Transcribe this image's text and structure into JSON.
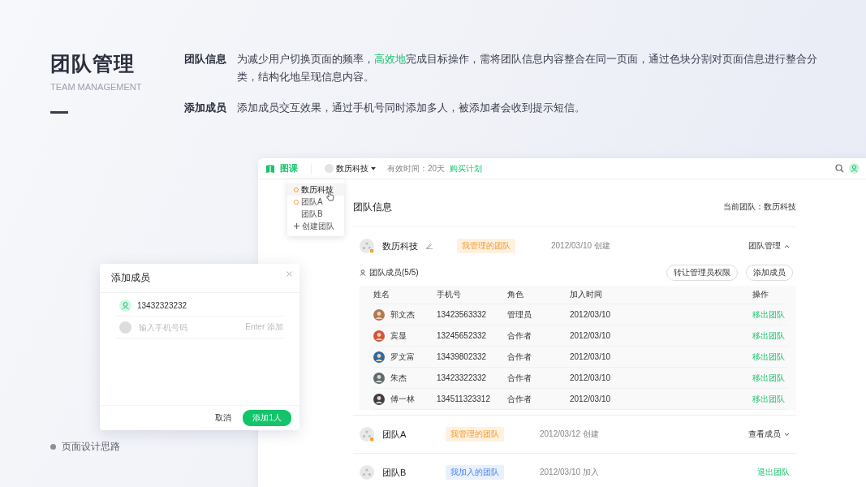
{
  "slide": {
    "title": "团队管理",
    "subtitle": "TEAM MANAGEMENT",
    "footer": "页面设计思路",
    "notes": [
      {
        "label": "团队信息",
        "text": "为减少用户切换页面的频率，**高效地**完成目标操作，需将团队信息内容整合在同一页面，通过色块分割对页面信息进行整合分类，结构化地呈现信息内容。"
      },
      {
        "label": "添加成员",
        "text": "添加成员交互效果，通过手机号同时添加多人，被添加者会收到提示短信。"
      }
    ]
  },
  "app": {
    "logo": "图课",
    "team_switcher": "数历科技",
    "validity": "有效时间：20天",
    "purchase_link": "购买计划",
    "team_menu": [
      {
        "kind": "team",
        "label": "数历科技",
        "managed": true,
        "selected": true
      },
      {
        "kind": "team",
        "label": "团队A",
        "managed": true,
        "selected": false
      },
      {
        "kind": "team",
        "label": "团队B",
        "managed": false,
        "selected": false
      },
      {
        "kind": "create",
        "label": "创建团队",
        "selected": false
      }
    ],
    "page_title": "团队信息",
    "current_team_label": "当前团队：",
    "current_team": "数历科技",
    "teams": [
      {
        "name": "数历科技",
        "editable": true,
        "tag": {
          "kind": "managed",
          "label": "我管理的团队"
        },
        "date": "2012/03/10 创建",
        "action": {
          "kind": "toggle",
          "label": "团队管理"
        },
        "expanded": true,
        "members_label": "团队成员(5/5)",
        "buttons": [
          "转让管理员权限",
          "添加成员"
        ],
        "columns": [
          "姓名",
          "手机号",
          "角色",
          "加入时间",
          "操作"
        ],
        "members": [
          {
            "name": "郭文杰",
            "phone": "13423563332",
            "role": "管理员",
            "joined": "2012/03/10",
            "action": "移出团队"
          },
          {
            "name": "宾显",
            "phone": "13245652332",
            "role": "合作者",
            "joined": "2012/03/10",
            "action": "移出团队"
          },
          {
            "name": "罗文富",
            "phone": "13439802332",
            "role": "合作者",
            "joined": "2012/03/10",
            "action": "移出团队"
          },
          {
            "name": "朱杰",
            "phone": "13423322332",
            "role": "合作者",
            "joined": "2012/03/10",
            "action": "移出团队"
          },
          {
            "name": "傅一林",
            "phone": "134511323312",
            "role": "合作者",
            "joined": "2012/03/10",
            "action": "移出团队"
          }
        ]
      },
      {
        "name": "团队A",
        "tag": {
          "kind": "managed",
          "label": "我管理的团队"
        },
        "date": "2012/03/12 创建",
        "action": {
          "kind": "toggle",
          "label": "查看成员"
        },
        "expanded": false
      },
      {
        "name": "团队B",
        "tag": {
          "kind": "joined",
          "label": "我加入的团队"
        },
        "date": "2012/03/10 加入",
        "action": {
          "kind": "link",
          "label": "退出团队"
        }
      }
    ]
  },
  "dialog": {
    "title": "添加成员",
    "entries": [
      {
        "value": "13432323232"
      }
    ],
    "input": {
      "placeholder": "输入手机号码",
      "hint": "Enter 添加"
    },
    "cancel": "取消",
    "confirm": "添加1人"
  }
}
